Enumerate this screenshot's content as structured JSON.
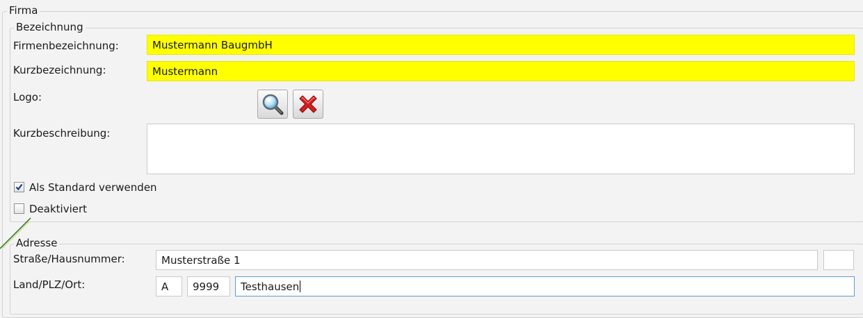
{
  "firma": {
    "legend": "Firma",
    "bezeichnung": {
      "legend": "Bezeichnung",
      "firmenbezeichnung_label": "Firmenbezeichnung:",
      "firmenbezeichnung_value": "Mustermann BaugmbH",
      "kurzbezeichnung_label": "Kurzbezeichnung:",
      "kurzbezeichnung_value": "Mustermann",
      "logo_label": "Logo:",
      "logo_search_icon": "magnifier-icon",
      "logo_delete_icon": "red-x-icon",
      "kurzbeschreibung_label": "Kurzbeschreibung:",
      "kurzbeschreibung_value": "",
      "standard_label": "Als Standard verwenden",
      "standard_checked": true,
      "deaktiviert_label": "Deaktiviert",
      "deaktiviert_checked": false
    },
    "adresse": {
      "legend": "Adresse",
      "strasse_label": "Straße/Hausnummer:",
      "strasse_value": "Musterstraße 1",
      "hausnummer_value": "",
      "land_label": "Land/PLZ/Ort:",
      "land_value": "A",
      "plz_value": "9999",
      "ort_value": "Testhausen"
    }
  },
  "colors": {
    "required_field": "#ffff00",
    "focus_border": "#5b9bd5",
    "delete_red": "#d21f1f"
  }
}
